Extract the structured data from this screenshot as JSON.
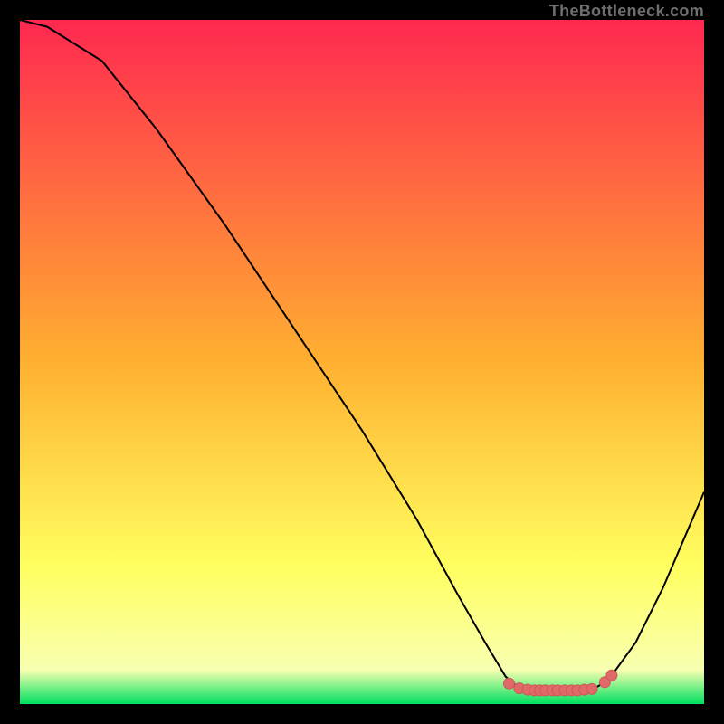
{
  "watermark": "TheBottleneck.com",
  "colors": {
    "page_bg": "#000000",
    "gradient_stops": [
      {
        "offset": "0%",
        "color": "#ff2850"
      },
      {
        "offset": "50%",
        "color": "#ffb030"
      },
      {
        "offset": "80%",
        "color": "#ffff60"
      },
      {
        "offset": "95%",
        "color": "#f8ffb0"
      },
      {
        "offset": "100%",
        "color": "#00e060"
      }
    ],
    "curve_stroke": "#000000",
    "marker_fill": "#e06a6a",
    "marker_stroke": "#d05555"
  },
  "chart_data": {
    "type": "line",
    "title": "",
    "xlabel": "",
    "ylabel": "",
    "xlim": [
      0,
      100
    ],
    "ylim": [
      0,
      100
    ],
    "curve": [
      {
        "x": 0,
        "y": 100
      },
      {
        "x": 4,
        "y": 99
      },
      {
        "x": 12,
        "y": 94
      },
      {
        "x": 20,
        "y": 84
      },
      {
        "x": 30,
        "y": 70
      },
      {
        "x": 40,
        "y": 55
      },
      {
        "x": 50,
        "y": 40
      },
      {
        "x": 58,
        "y": 27
      },
      {
        "x": 64,
        "y": 16
      },
      {
        "x": 68,
        "y": 9
      },
      {
        "x": 71,
        "y": 4
      },
      {
        "x": 73,
        "y": 2.3
      },
      {
        "x": 75,
        "y": 2.0
      },
      {
        "x": 78,
        "y": 2.0
      },
      {
        "x": 81,
        "y": 2.0
      },
      {
        "x": 84,
        "y": 2.3
      },
      {
        "x": 86,
        "y": 3.5
      },
      {
        "x": 90,
        "y": 9
      },
      {
        "x": 94,
        "y": 17
      },
      {
        "x": 100,
        "y": 31
      }
    ],
    "markers": [
      {
        "x": 71.5,
        "y": 3.0
      },
      {
        "x": 73.0,
        "y": 2.3
      },
      {
        "x": 74.2,
        "y": 2.1
      },
      {
        "x": 75.2,
        "y": 2.0
      },
      {
        "x": 76.0,
        "y": 2.0
      },
      {
        "x": 76.8,
        "y": 2.0
      },
      {
        "x": 77.8,
        "y": 2.0
      },
      {
        "x": 78.6,
        "y": 2.0
      },
      {
        "x": 79.6,
        "y": 2.0
      },
      {
        "x": 80.6,
        "y": 2.0
      },
      {
        "x": 81.5,
        "y": 2.0
      },
      {
        "x": 82.5,
        "y": 2.1
      },
      {
        "x": 83.6,
        "y": 2.2
      },
      {
        "x": 85.5,
        "y": 3.2
      },
      {
        "x": 86.5,
        "y": 4.2
      }
    ]
  }
}
